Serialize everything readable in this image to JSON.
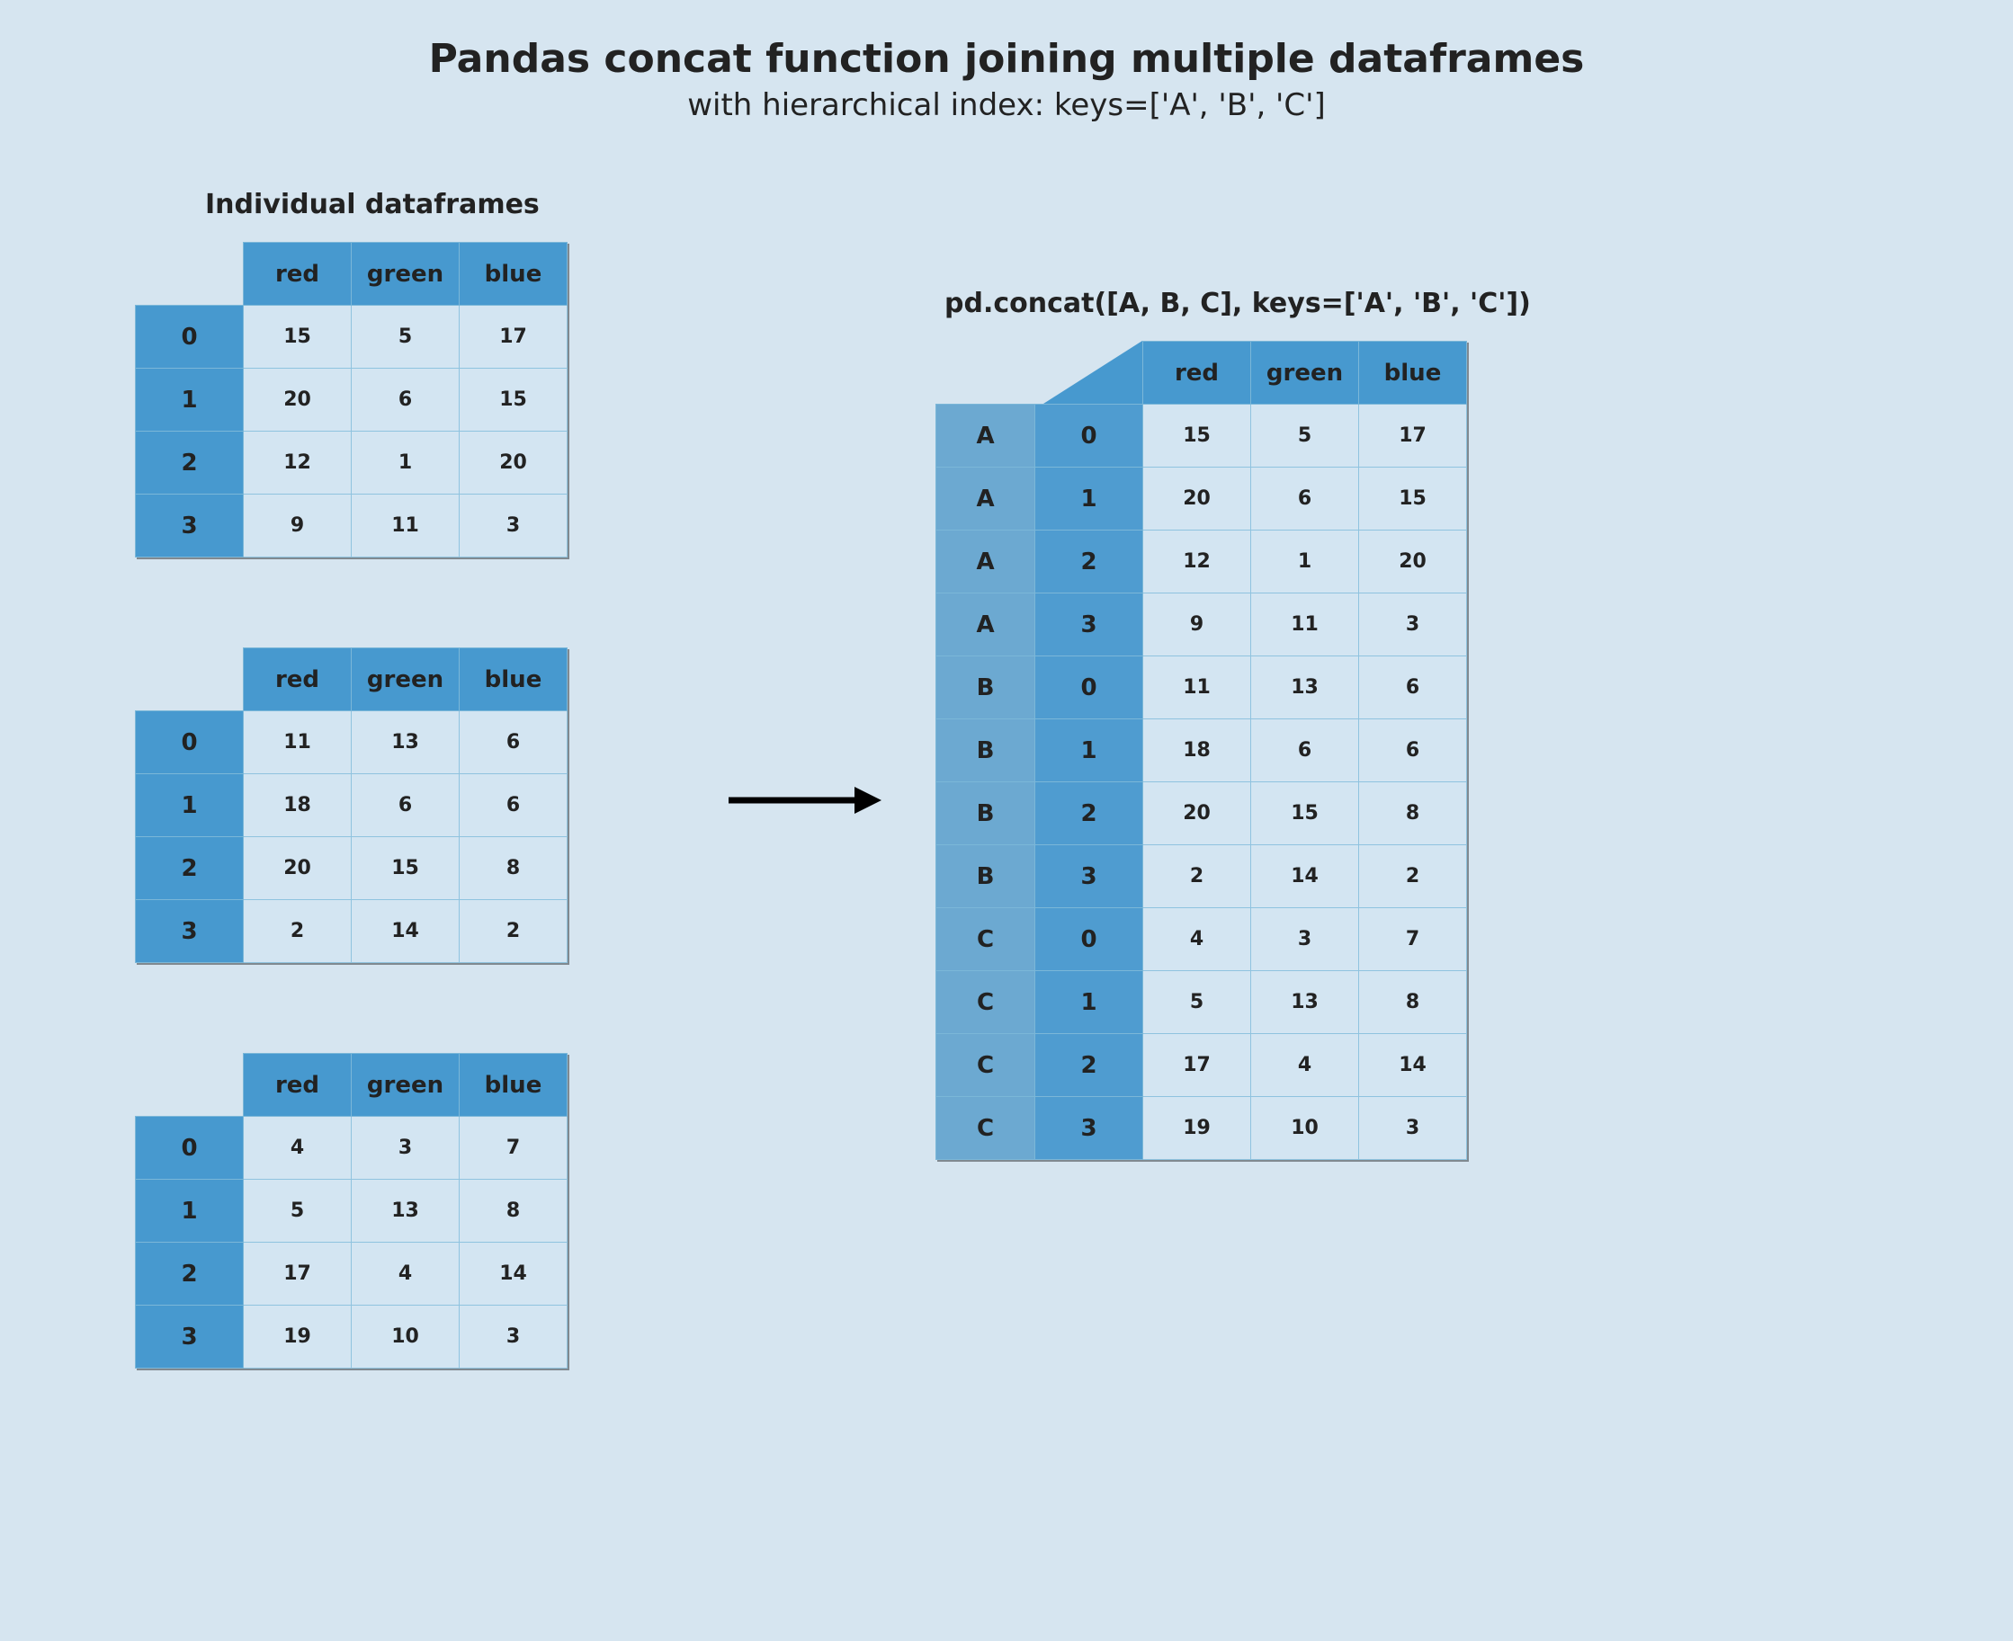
{
  "title": "Pandas concat function joining multiple dataframes",
  "subtitle": "with hierarchical index: keys=['A', 'B', 'C']",
  "left_heading": "Individual dataframes",
  "right_heading": "pd.concat([A, B, C], keys=['A', 'B', 'C'])",
  "columns": [
    "red",
    "green",
    "blue"
  ],
  "indices": [
    "0",
    "1",
    "2",
    "3"
  ],
  "keys": [
    "A",
    "B",
    "C"
  ],
  "frames": [
    [
      [
        15,
        5,
        17
      ],
      [
        20,
        6,
        15
      ],
      [
        12,
        1,
        20
      ],
      [
        9,
        11,
        3
      ]
    ],
    [
      [
        11,
        13,
        6
      ],
      [
        18,
        6,
        6
      ],
      [
        20,
        15,
        8
      ],
      [
        2,
        14,
        2
      ]
    ],
    [
      [
        4,
        3,
        7
      ],
      [
        5,
        13,
        8
      ],
      [
        17,
        4,
        14
      ],
      [
        19,
        10,
        3
      ]
    ]
  ],
  "concat": [
    [
      "A",
      "0",
      15,
      5,
      17
    ],
    [
      "A",
      "1",
      20,
      6,
      15
    ],
    [
      "A",
      "2",
      12,
      1,
      20
    ],
    [
      "A",
      "3",
      9,
      11,
      3
    ],
    [
      "B",
      "0",
      11,
      13,
      6
    ],
    [
      "B",
      "1",
      18,
      6,
      6
    ],
    [
      "B",
      "2",
      20,
      15,
      8
    ],
    [
      "B",
      "3",
      2,
      14,
      2
    ],
    [
      "C",
      "0",
      4,
      3,
      7
    ],
    [
      "C",
      "1",
      5,
      13,
      8
    ],
    [
      "C",
      "2",
      17,
      4,
      14
    ],
    [
      "C",
      "3",
      19,
      10,
      3
    ]
  ]
}
